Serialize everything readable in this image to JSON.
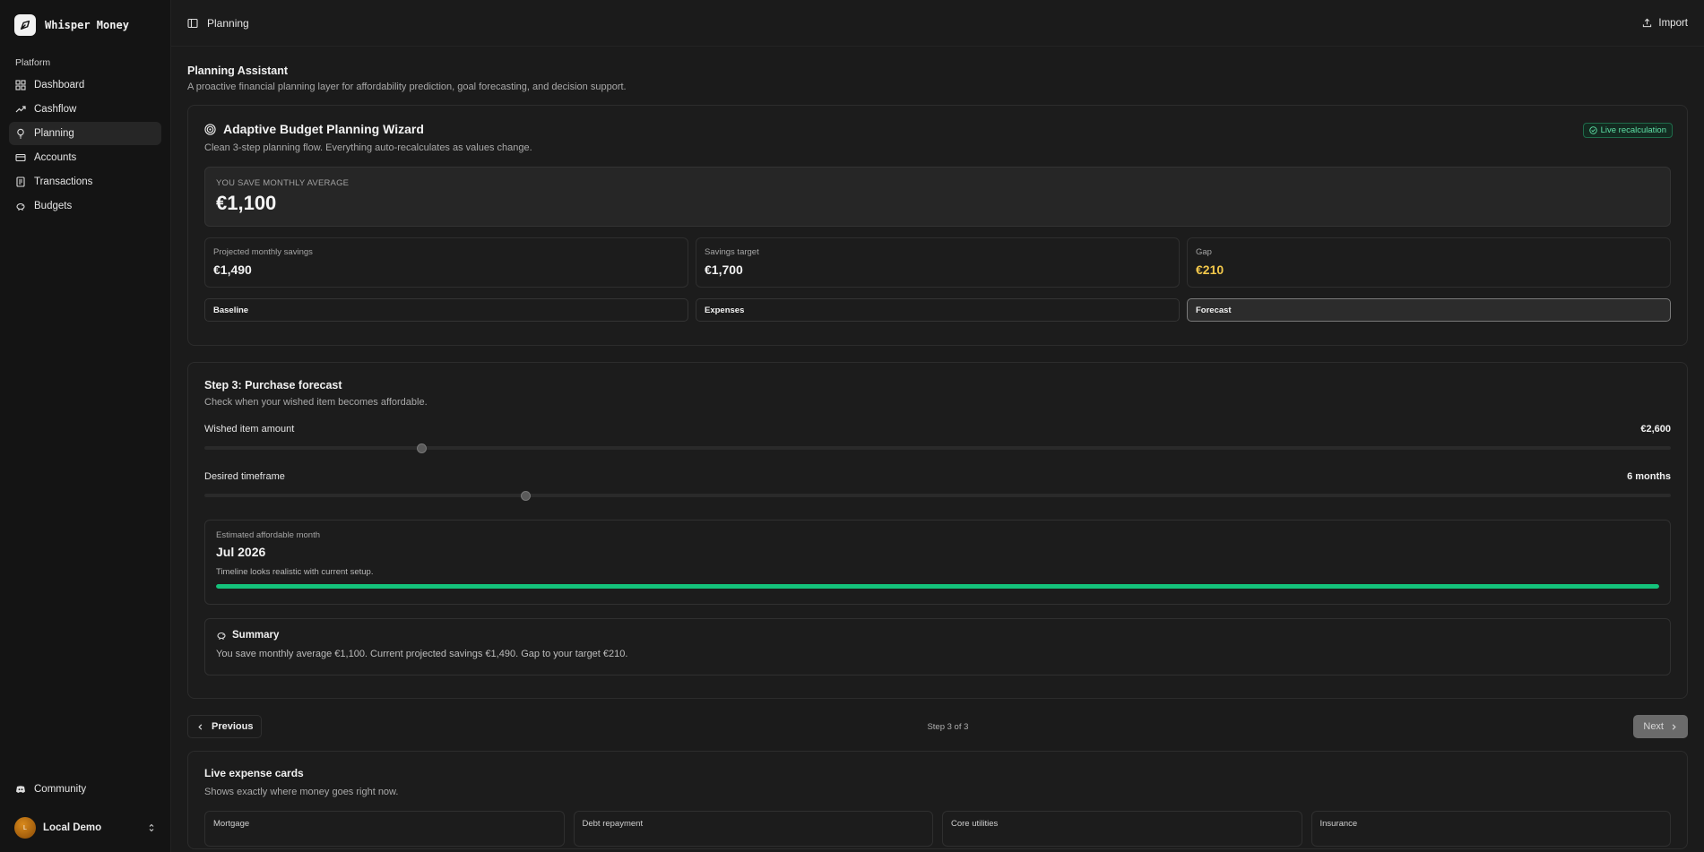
{
  "app": {
    "name": "Whisper Money"
  },
  "sidebar": {
    "section_label": "Platform",
    "items": [
      {
        "label": "Dashboard",
        "icon": "dashboard-grid-icon"
      },
      {
        "label": "Cashflow",
        "icon": "trending-up-icon"
      },
      {
        "label": "Planning",
        "icon": "lightbulb-icon",
        "active": true
      },
      {
        "label": "Accounts",
        "icon": "credit-card-icon"
      },
      {
        "label": "Transactions",
        "icon": "receipt-icon"
      },
      {
        "label": "Budgets",
        "icon": "piggy-bank-icon"
      }
    ],
    "community_label": "Community",
    "user": {
      "name": "Local Demo",
      "initial": "L"
    }
  },
  "topbar": {
    "title": "Planning",
    "import_label": "Import"
  },
  "page": {
    "title": "Planning Assistant",
    "subtitle": "A proactive financial planning layer for affordability prediction, goal forecasting, and decision support."
  },
  "wizard": {
    "title": "Adaptive Budget Planning Wizard",
    "badge": "Live recalculation",
    "subtitle": "Clean 3-step planning flow. Everything auto-recalculates as values change.",
    "save_label": "YOU SAVE MONTHLY AVERAGE",
    "save_value": "€1,100",
    "stats": [
      {
        "label": "Projected monthly savings",
        "value": "€1,490"
      },
      {
        "label": "Savings target",
        "value": "€1,700"
      },
      {
        "label": "Gap",
        "value": "€210"
      }
    ],
    "steps": [
      "Baseline",
      "Expenses",
      "Forecast"
    ],
    "active_step": 2
  },
  "forecast": {
    "title": "Step 3: Purchase forecast",
    "subtitle": "Check when your wished item becomes affordable.",
    "item_amount": {
      "label": "Wished item amount",
      "value": "€2,600",
      "level": 0.148
    },
    "timeframe": {
      "label": "Desired timeframe",
      "value": "6 months",
      "level": 0.219
    },
    "affordable": {
      "label": "Estimated affordable month",
      "value": "Jul 2026",
      "note": "Timeline looks realistic with current setup.",
      "progress": 1.0
    },
    "summary": {
      "title": "Summary",
      "text": "You save monthly average €1,100. Current projected savings €1,490. Gap to your target €210."
    }
  },
  "pager": {
    "prev_label": "Previous",
    "step_text": "Step 3 of 3",
    "next_label": "Next"
  },
  "live_cards": {
    "title": "Live expense cards",
    "subtitle": "Shows exactly where money goes right now.",
    "cards": [
      "Mortgage",
      "Debt repayment",
      "Core utilities",
      "Insurance"
    ]
  },
  "colors": {
    "accent_green": "#14c27b",
    "gap_yellow": "#f3c84b",
    "badge_green": "#5fe0a6"
  }
}
